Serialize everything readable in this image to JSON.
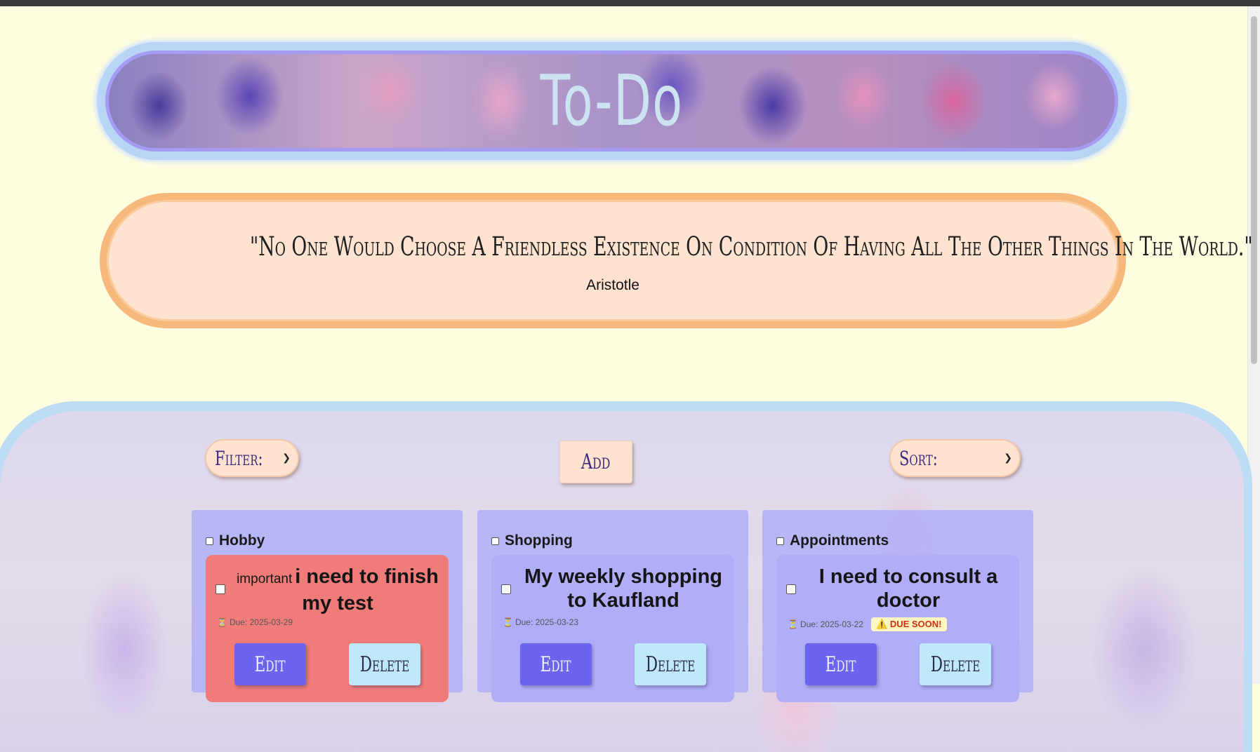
{
  "header": {
    "title": "To-Do"
  },
  "quote": {
    "text": "\"No One Would Choose A Friendless Existence On Condition Of Having All The Other Things In The World.\"",
    "author": "Aristotle"
  },
  "controls": {
    "filter_label": "Filter:",
    "add_label": "Add",
    "sort_label": "Sort:"
  },
  "columns": [
    {
      "title": "Hobby",
      "card": {
        "tag": "important",
        "text": "i need to finish my test",
        "due": "Due: 2025-03-29",
        "due_soon": "",
        "important": true,
        "edit": "Edit",
        "delete": "Delete"
      }
    },
    {
      "title": "Shopping",
      "card": {
        "tag": "",
        "text": "My weekly shopping to Kaufland",
        "due": "Due: 2025-03-23",
        "due_soon": "",
        "important": false,
        "edit": "Edit",
        "delete": "Delete"
      }
    },
    {
      "title": "Appointments",
      "card": {
        "tag": "",
        "text": "I need to consult a doctor",
        "due": "Due: 2025-03-22",
        "due_soon": "⚠️ DUE SOON!",
        "important": false,
        "edit": "Edit",
        "delete": "Delete"
      }
    }
  ],
  "icons": {
    "due": "hourglass-icon",
    "warning": "warning-icon",
    "select_arrow": "chevron-down-icon"
  },
  "colors": {
    "page_bg": "#fefde0",
    "banner_border": "#a59bf2",
    "quote_bg": "#fee4d0",
    "quote_border": "#f7b87b",
    "column_bg": "#afaff8",
    "important_card": "#f07c79",
    "edit_button": "#6c63ee",
    "delete_button": "#bfe8f8",
    "due_soon": "#d22e12"
  }
}
